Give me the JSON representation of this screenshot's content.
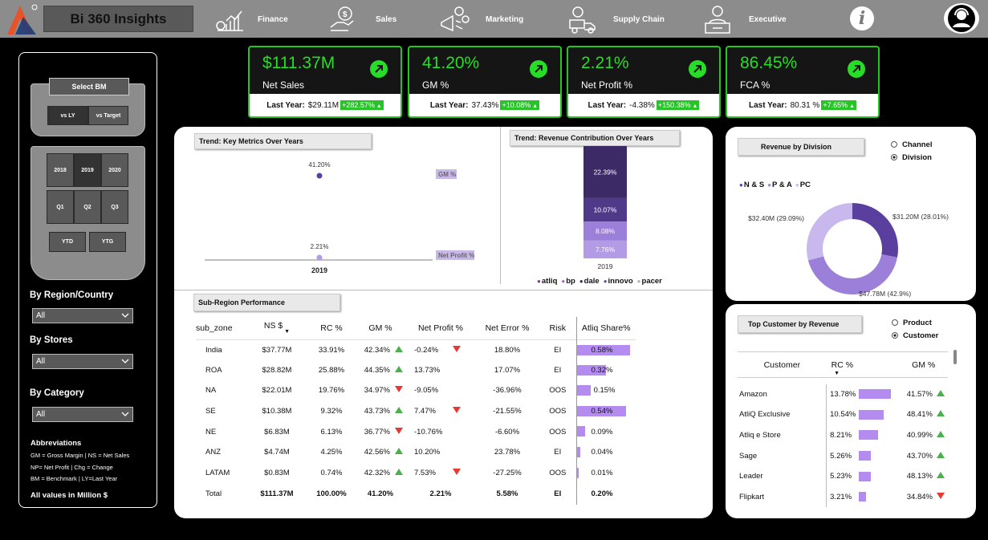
{
  "header": {
    "title": "Bi 360 Insights",
    "nav": [
      {
        "label": "Finance",
        "icon": "finance-chart-icon"
      },
      {
        "label": "Sales",
        "icon": "sales-hand-coin-icon"
      },
      {
        "label": "Marketing",
        "icon": "marketing-megaphone-icon"
      },
      {
        "label": "Supply Chain",
        "icon": "supply-chain-truck-icon"
      },
      {
        "label": "Executive",
        "icon": "executive-desk-icon"
      }
    ],
    "info_glyph": "i"
  },
  "left": {
    "select_bm": "Select BM",
    "bm_options": [
      "vs LY",
      "vs Target"
    ],
    "years": [
      "2018",
      "2019",
      "2020"
    ],
    "selected_year": "2019",
    "quarters": [
      "Q1",
      "Q2",
      "Q3"
    ],
    "periods": [
      "YTD",
      "YTG"
    ],
    "region_label": "By Region/Country",
    "region_value": "All",
    "stores_label": "By Stores",
    "stores_value": "All",
    "category_label": "By Category",
    "category_value": "All",
    "abbr_title": "Abbreviations",
    "abbr_lines": [
      "GM = Gross Margin | NS = Net Sales",
      "NP= Net Profit | Chg = Change",
      "BM = Benchmark | LY=Last Year"
    ],
    "abbr_footer": "All values in Million $"
  },
  "kpis": [
    {
      "value": "$111.37M",
      "name": "Net Sales",
      "ly_label": "Last Year:",
      "ly": "$29.11M",
      "chg": "+282.57%"
    },
    {
      "value": "41.20%",
      "name": "GM %",
      "ly_label": "Last Year:",
      "ly": "37.43%",
      "chg": "+10.08%"
    },
    {
      "value": "2.21%",
      "name": "Net Profit %",
      "ly_label": "Last Year:",
      "ly": "-4.38%",
      "chg": "+150.38%"
    },
    {
      "value": "86.45%",
      "name": "FCA %",
      "ly_label": "Last Year:",
      "ly": "80.31 %",
      "chg": "+7.65%"
    }
  ],
  "trend": {
    "title": "Trend: Key Metrics Over Years",
    "gm_label": "41.20%",
    "np_label": "2.21%",
    "year": "2019",
    "legend_gm": "GM %",
    "legend_np": "Net Profit %"
  },
  "revenue_contrib": {
    "title": "Trend: Revenue Contribution Over Years",
    "year": "2019",
    "segments": [
      {
        "label": "22.39%",
        "value": 22.39,
        "color": "#3b2a66"
      },
      {
        "label": "10.07%",
        "value": 10.07,
        "color": "#4f3a8a"
      },
      {
        "label": "8.08%",
        "value": 8.08,
        "color": "#9b7fd9"
      },
      {
        "label": "7.76%",
        "value": 7.76,
        "color": "#b49be6"
      }
    ],
    "legend": [
      {
        "label": "atliq",
        "color": "#7a3a8a"
      },
      {
        "label": "bp",
        "color": "#9b6fd0"
      },
      {
        "label": "dale",
        "color": "#3b2a66"
      },
      {
        "label": "innovo",
        "color": "#6a4fa8"
      },
      {
        "label": "pacer",
        "color": "#b9a4e8"
      }
    ]
  },
  "sub_region": {
    "title": "Sub-Region Performance",
    "headers": [
      "sub_zone",
      "NS $",
      "RC %",
      "GM %",
      "Net Profit %",
      "Net Error %",
      "Risk",
      "Atliq Share%"
    ],
    "rows": [
      {
        "zone": "India",
        "ns": "$37.77M",
        "rc": "33.91%",
        "gm": "42.34%",
        "gm_dir": "up",
        "np": "-0.24%",
        "np_dir": "down",
        "ne": "18.80%",
        "risk": "EI",
        "share": "0.58%",
        "share_v": 0.58
      },
      {
        "zone": "ROA",
        "ns": "$28.82M",
        "rc": "25.88%",
        "gm": "44.35%",
        "gm_dir": "up",
        "np": "13.73%",
        "np_dir": "",
        "ne": "17.07%",
        "risk": "EI",
        "share": "0.32%",
        "share_v": 0.32
      },
      {
        "zone": "NA",
        "ns": "$22.01M",
        "rc": "19.76%",
        "gm": "34.97%",
        "gm_dir": "down",
        "np": "-9.05%",
        "np_dir": "",
        "ne": "-36.96%",
        "risk": "OOS",
        "share": "0.15%",
        "share_v": 0.15
      },
      {
        "zone": "SE",
        "ns": "$10.38M",
        "rc": "9.32%",
        "gm": "43.73%",
        "gm_dir": "up",
        "np": "7.47%",
        "np_dir": "down",
        "ne": "-21.55%",
        "risk": "OOS",
        "share": "0.54%",
        "share_v": 0.54
      },
      {
        "zone": "NE",
        "ns": "$6.83M",
        "rc": "6.13%",
        "gm": "36.77%",
        "gm_dir": "down",
        "np": "-10.76%",
        "np_dir": "",
        "ne": "-6.60%",
        "risk": "OOS",
        "share": "0.09%",
        "share_v": 0.09
      },
      {
        "zone": "ANZ",
        "ns": "$4.74M",
        "rc": "4.25%",
        "gm": "42.56%",
        "gm_dir": "up",
        "np": "10.20%",
        "np_dir": "",
        "ne": "23.78%",
        "risk": "EI",
        "share": "0.04%",
        "share_v": 0.04
      },
      {
        "zone": "LATAM",
        "ns": "$0.83M",
        "rc": "0.74%",
        "gm": "42.32%",
        "gm_dir": "up",
        "np": "7.53%",
        "np_dir": "down",
        "ne": "-27.25%",
        "risk": "OOS",
        "share": "0.01%",
        "share_v": 0.01
      }
    ],
    "total": {
      "zone": "Total",
      "ns": "$111.37M",
      "rc": "100.00%",
      "gm": "41.20%",
      "np": "2.21%",
      "ne": "5.58%",
      "risk": "EI",
      "share": "0.20%"
    }
  },
  "division": {
    "title": "Revenue by Division",
    "radio": [
      "Channel",
      "Division"
    ],
    "radio_selected": "Division",
    "legend": [
      {
        "label": "N & S",
        "color": "#5b3f9e"
      },
      {
        "label": "P & A",
        "color": "#9b7fd9"
      },
      {
        "label": "PC",
        "color": "#c9b8ee"
      }
    ],
    "slices": [
      {
        "name": "N & S",
        "value": 31.2,
        "label": "$31.20M (28.01%)",
        "color": "#5b3f9e"
      },
      {
        "name": "P & A",
        "value": 47.78,
        "label": "$47.78M (42.9%)",
        "color": "#9b7fd9"
      },
      {
        "name": "PC",
        "value": 32.4,
        "label": "$32.40M (29.09%)",
        "color": "#c9b8ee"
      }
    ]
  },
  "top_customer": {
    "title": "Top Customer by Revenue",
    "radio": [
      "Product",
      "Customer"
    ],
    "radio_selected": "Customer",
    "headers": [
      "Customer",
      "RC %",
      "GM %"
    ],
    "rows": [
      {
        "name": "Amazon",
        "rc": "13.78%",
        "rc_v": 13.78,
        "gm": "41.57%",
        "dir": "up"
      },
      {
        "name": "AtliQ Exclusive",
        "rc": "10.54%",
        "rc_v": 10.54,
        "gm": "48.41%",
        "dir": "up"
      },
      {
        "name": "Atliq e Store",
        "rc": "8.21%",
        "rc_v": 8.21,
        "gm": "40.99%",
        "dir": "up"
      },
      {
        "name": "Sage",
        "rc": "5.26%",
        "rc_v": 5.26,
        "gm": "43.70%",
        "dir": "up"
      },
      {
        "name": "Leader",
        "rc": "5.23%",
        "rc_v": 5.23,
        "gm": "48.13%",
        "dir": "up"
      },
      {
        "name": "Flipkart",
        "rc": "3.21%",
        "rc_v": 3.21,
        "gm": "34.84%",
        "dir": "down"
      }
    ]
  },
  "colors": {
    "accent": "#27c427",
    "bar": "#b48cf0",
    "header": "#8c8c8c"
  }
}
